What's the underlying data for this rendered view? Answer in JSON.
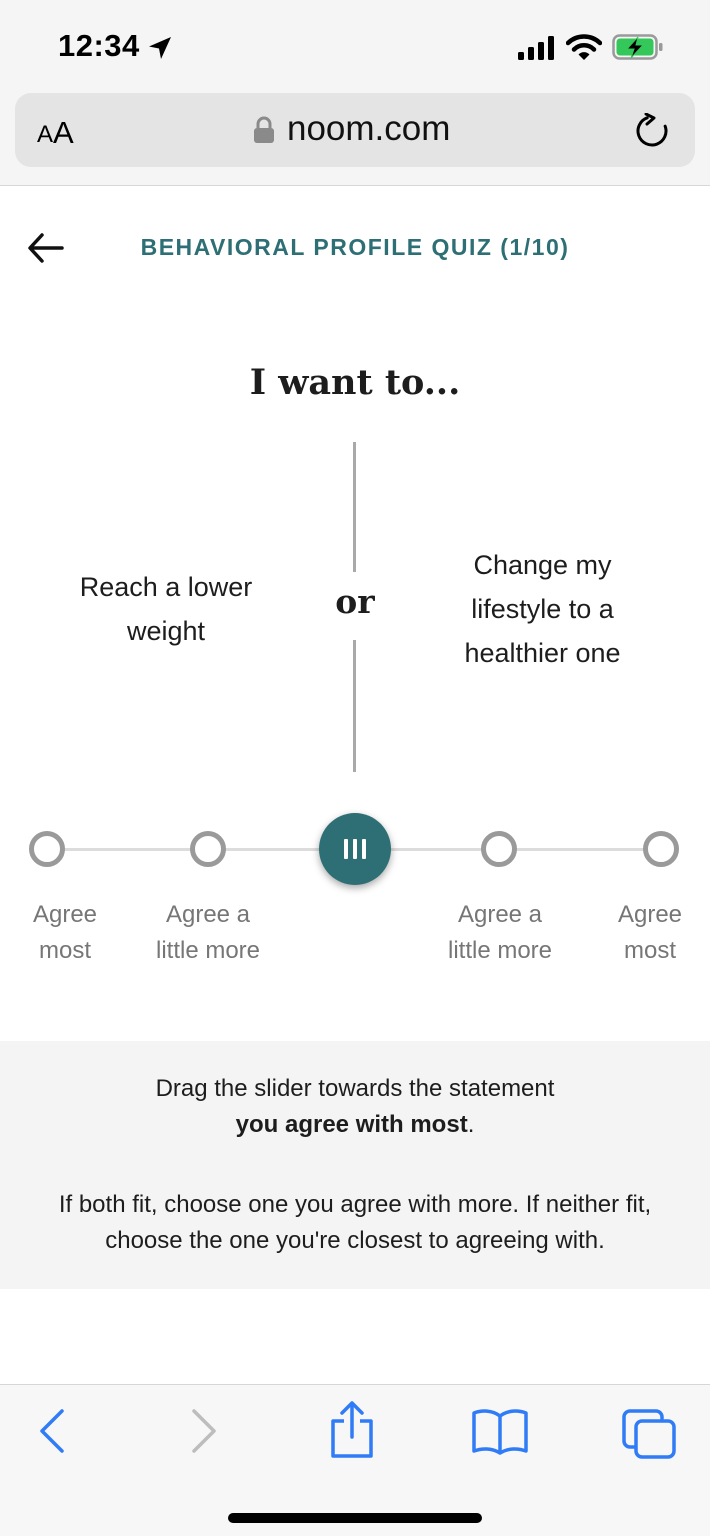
{
  "status_bar": {
    "time": "12:34",
    "icons": [
      "location-arrow-icon",
      "cellular-signal-icon",
      "wifi-icon",
      "battery-charging-icon"
    ],
    "battery_color": "#34c759"
  },
  "browser": {
    "text_size_small": "A",
    "text_size_big": "A",
    "url": "noom.com"
  },
  "quiz": {
    "title": "BEHAVIORAL PROFILE QUIZ (1/10)",
    "question": "I want to...",
    "statement_left": "Reach a lower weight",
    "separator": "or",
    "statement_right": "Change my lifestyle to a healthier one",
    "accent_color": "#2d6f75"
  },
  "slider": {
    "labels": [
      {
        "line1": "Agree",
        "line2": "most"
      },
      {
        "line1": "Agree a",
        "line2": "little more"
      },
      {
        "line1": "Agree a",
        "line2": "little more"
      },
      {
        "line1": "Agree",
        "line2": "most"
      }
    ],
    "position": "center",
    "stops": 5
  },
  "instructions": {
    "line1": "Drag the slider towards the statement",
    "line2_bold": "you agree with most",
    "line2_end": ".",
    "line3": "If both fit, choose one you agree with more. If neither fit, choose the one you're closest to agreeing with."
  },
  "toolbar": {
    "icons": [
      "back-chevron-icon",
      "forward-chevron-icon",
      "share-icon",
      "bookmarks-icon",
      "tabs-icon"
    ],
    "icon_color": "#2f7cf6"
  }
}
